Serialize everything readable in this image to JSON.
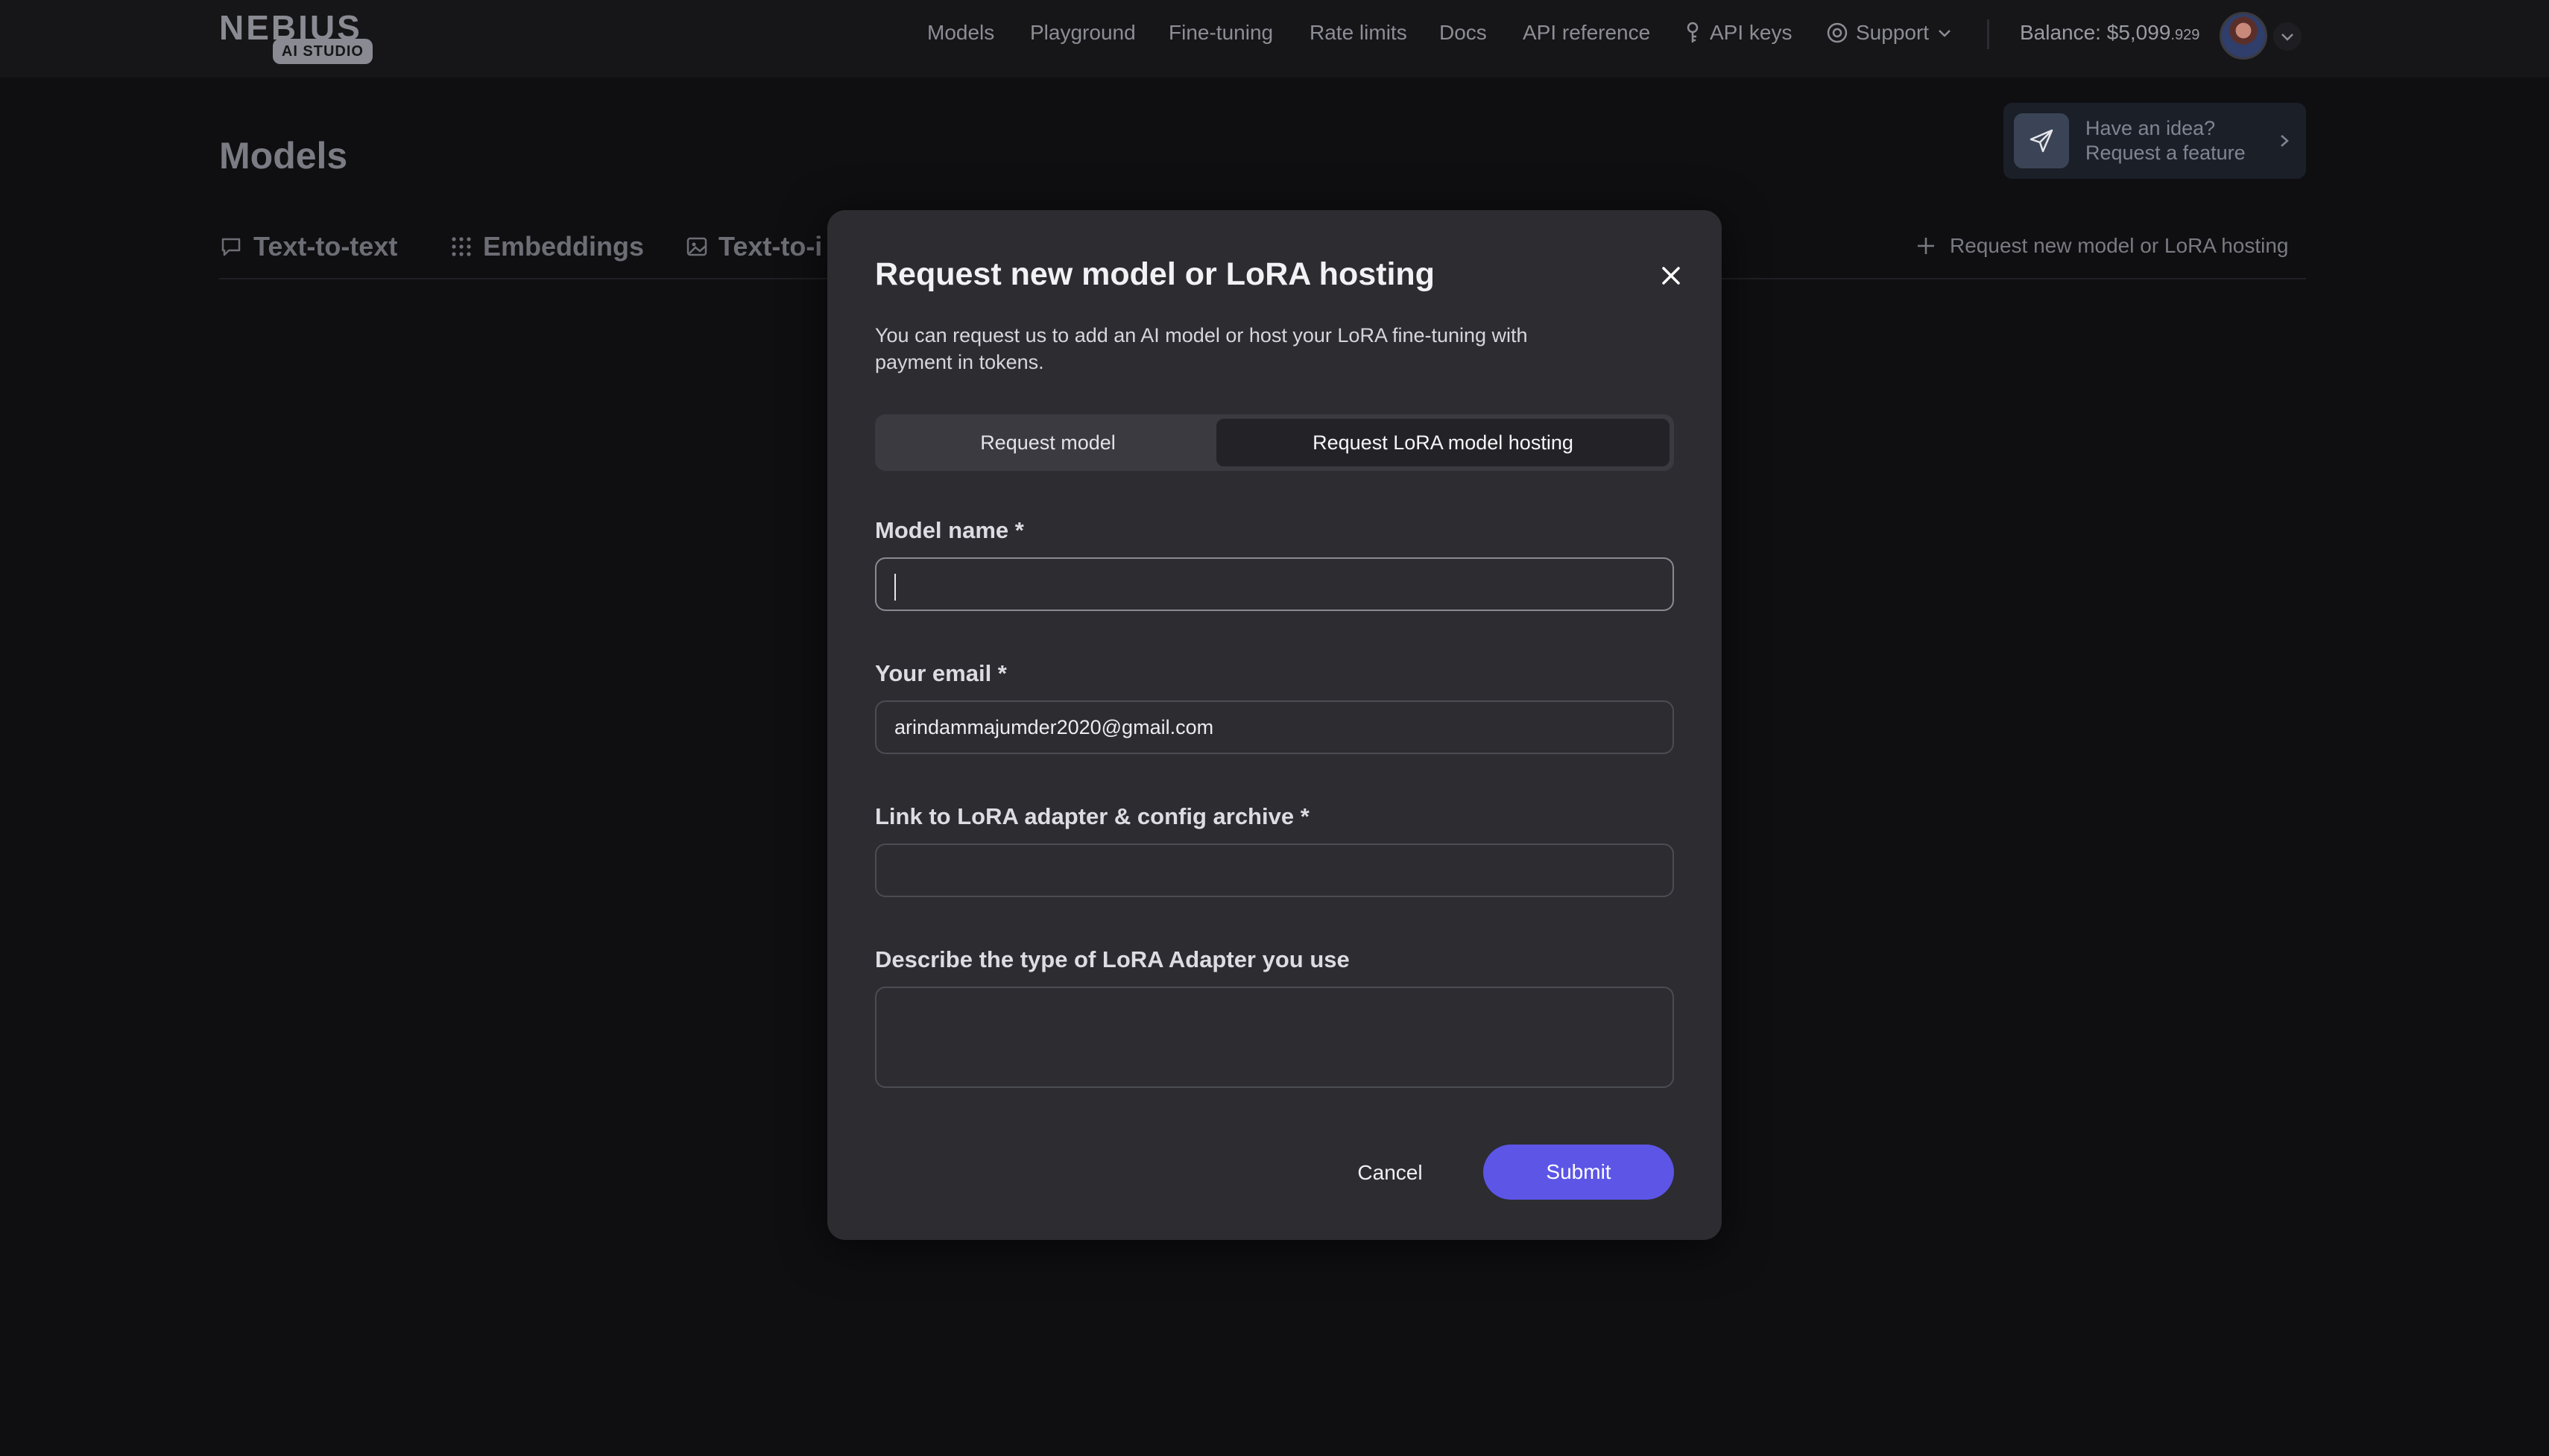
{
  "brand": {
    "name": "NEBIUS",
    "badge": "AI STUDIO"
  },
  "nav": {
    "items": [
      "Models",
      "Playground",
      "Fine-tuning",
      "Rate limits",
      "Docs",
      "API reference",
      "API keys",
      "Support"
    ],
    "balance_label": "Balance: $5,099",
    "balance_fraction": ".929"
  },
  "page": {
    "title": "Models",
    "idea": {
      "line1": "Have an idea?",
      "line2": "Request a feature"
    },
    "tabs": [
      "Text-to-text",
      "Embeddings",
      "Text-to-i"
    ],
    "request_link": "Request new model or LoRA hosting"
  },
  "modal": {
    "title": "Request new model or LoRA hosting",
    "description": "You can request us to add an AI model or host your LoRA fine-tuning with payment in tokens.",
    "segments": [
      "Request model",
      "Request LoRA model hosting"
    ],
    "active_segment": "Request LoRA model hosting",
    "fields": {
      "model_name": {
        "label": "Model name *",
        "value": ""
      },
      "email": {
        "label": "Your email *",
        "value": "arindammajumder2020@gmail.com"
      },
      "lora_link": {
        "label": "Link to LoRA adapter & config archive *",
        "value": ""
      },
      "adapter_type": {
        "label": "Describe the type of LoRA Adapter you use",
        "value": ""
      }
    },
    "cancel_label": "Cancel",
    "submit_label": "Submit"
  },
  "colors": {
    "accent": "#5c55e6",
    "background": "#0f0f12",
    "modal": "#2c2c31"
  },
  "icons": [
    "send-icon",
    "chevron-right-icon",
    "chevron-down-icon",
    "key-icon",
    "support-icon",
    "plus-icon",
    "close-icon",
    "chat-icon",
    "grid-icon",
    "image-icon"
  ]
}
